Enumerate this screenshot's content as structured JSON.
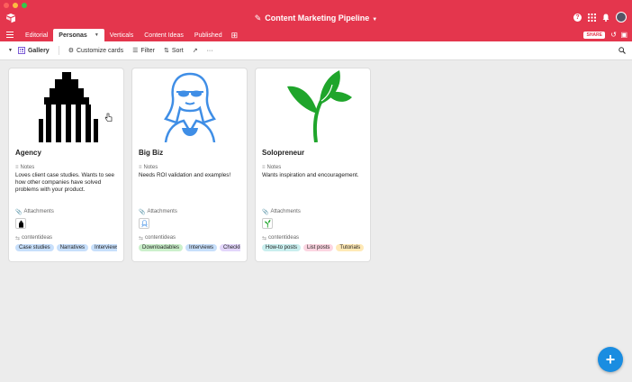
{
  "header": {
    "base_title": "Content Marketing Pipeline",
    "brand_color": "#e4364d"
  },
  "tabs": [
    {
      "label": "Editorial",
      "active": false
    },
    {
      "label": "Personas",
      "active": true
    },
    {
      "label": "Verticals",
      "active": false
    },
    {
      "label": "Content Ideas",
      "active": false
    },
    {
      "label": "Published",
      "active": false
    }
  ],
  "share_label": "SHARE",
  "toolbar": {
    "view_name": "Gallery",
    "customize_label": "Customize cards",
    "filter_label": "Filter",
    "sort_label": "Sort",
    "more_label": "···"
  },
  "field_labels": {
    "notes": "Notes",
    "attachments": "Attachments",
    "contentideas": "contentideas"
  },
  "cards": [
    {
      "title": "Agency",
      "image": "building-icon",
      "notes": "Loves client case studies. Wants to see how other companies have solved problems with your product.",
      "tags": [
        {
          "label": "Case studies",
          "color": "#c7dffb"
        },
        {
          "label": "Narratives",
          "color": "#c7dffb"
        },
        {
          "label": "Interviews",
          "color": "#c7dffb"
        }
      ]
    },
    {
      "title": "Big Biz",
      "image": "businesswoman-icon",
      "notes": "Needs ROI validation and examples!",
      "tags": [
        {
          "label": "Downloadables",
          "color": "#cbf0cb"
        },
        {
          "label": "Interviews",
          "color": "#c7dffb"
        },
        {
          "label": "Checklists",
          "color": "#e3d6fb"
        }
      ]
    },
    {
      "title": "Solopreneur",
      "image": "sprout-icon",
      "notes": "Wants inspiration and encouragement.",
      "tags": [
        {
          "label": "How-to posts",
          "color": "#c9eeee"
        },
        {
          "label": "List posts",
          "color": "#fcd5e1"
        },
        {
          "label": "Tutorials",
          "color": "#ffe9b6"
        }
      ]
    }
  ]
}
